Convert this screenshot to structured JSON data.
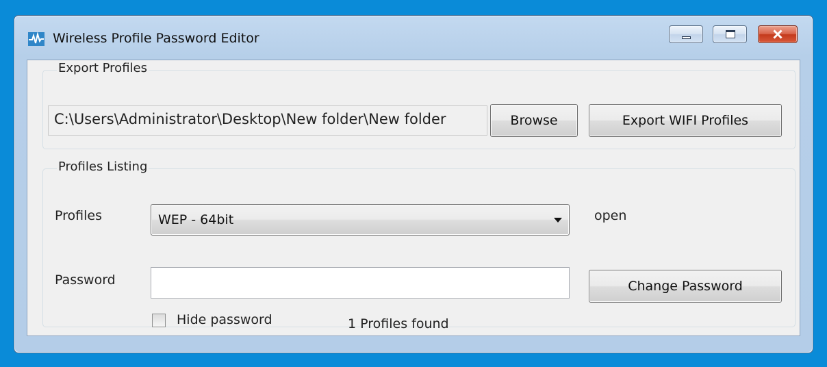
{
  "window": {
    "title": "Wireless Profile Password Editor"
  },
  "export_group": {
    "title": "Export Profiles",
    "path_value": "C:\\Users\\Administrator\\Desktop\\New folder\\New folder",
    "browse_label": "Browse",
    "export_label": "Export WIFI Profiles"
  },
  "listing_group": {
    "title": "Profiles Listing",
    "profiles_label": "Profiles",
    "profiles_selected": "WEP - 64bit",
    "security_text": "open",
    "password_label": "Password",
    "password_value": "",
    "change_label": "Change Password",
    "hide_label": "Hide password",
    "hide_checked": false,
    "count_text": "1 Profiles found"
  },
  "icons": {
    "app": "pulse-icon",
    "minimize": "minimize-icon",
    "maximize": "maximize-icon",
    "close": "close-icon",
    "dropdown": "chevron-down-icon"
  },
  "colors": {
    "desktop": "#0a8bd8",
    "frame": "#b6cfe9",
    "client": "#f0f0f0",
    "close_button": "#d9583a"
  }
}
